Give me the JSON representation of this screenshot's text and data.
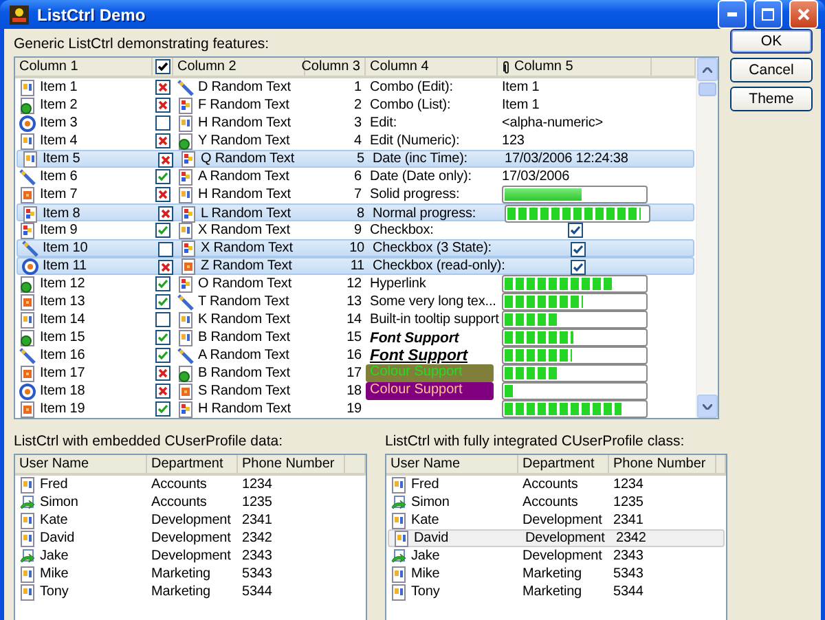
{
  "window": {
    "title": "ListCtrl Demo"
  },
  "main_list": {
    "label": "Generic ListCtrl demonstrating features:",
    "columns": [
      {
        "kind": "text",
        "label": "Column 1"
      },
      {
        "kind": "checkbox",
        "checked": true
      },
      {
        "kind": "text",
        "label": "Column 2"
      },
      {
        "kind": "number",
        "label": "Column 3"
      },
      {
        "kind": "text",
        "label": "Column 4"
      },
      {
        "kind": "attachment",
        "label": "Column 5"
      }
    ],
    "rows": [
      {
        "name": "Item 1",
        "checked": true,
        "crossed": true,
        "text2": "D Random Text",
        "number": "1",
        "label": {
          "kind": "plain",
          "text": "Combo (Edit):"
        },
        "value": {
          "kind": "text",
          "text": "Item 1"
        },
        "selected": false
      },
      {
        "name": "Item 2",
        "checked": true,
        "crossed": true,
        "text2": "F Random Text",
        "number": "2",
        "label": {
          "kind": "plain",
          "text": "Combo (List):"
        },
        "value": {
          "kind": "text",
          "text": "Item 1"
        },
        "selected": false
      },
      {
        "name": "Item 3",
        "checked": false,
        "text2": "H Random Text",
        "number": "3",
        "label": {
          "kind": "plain",
          "text": "Edit:"
        },
        "value": {
          "kind": "text",
          "text": "<alpha-numeric>"
        },
        "selected": false
      },
      {
        "name": "Item 4",
        "checked": true,
        "crossed": true,
        "text2": "Y Random Text",
        "number": "4",
        "label": {
          "kind": "plain",
          "text": "Edit (Numeric):"
        },
        "value": {
          "kind": "text",
          "text": "123"
        },
        "selected": false
      },
      {
        "name": "Item 5",
        "checked": true,
        "crossed": true,
        "text2": "Q Random Text",
        "number": "5",
        "label": {
          "kind": "plain",
          "text": "Date (inc Time):"
        },
        "value": {
          "kind": "text",
          "text": "17/03/2006 12:24:38"
        },
        "selected": true
      },
      {
        "name": "Item 6",
        "checked": true,
        "crossed": false,
        "text2": "A Random Text",
        "number": "6",
        "label": {
          "kind": "plain",
          "text": "Date (Date only):"
        },
        "value": {
          "kind": "text",
          "text": "17/03/2006"
        },
        "selected": false
      },
      {
        "name": "Item 7",
        "checked": true,
        "crossed": true,
        "text2": "H Random Text",
        "number": "7",
        "label": {
          "kind": "plain",
          "text": "Solid progress:"
        },
        "value": {
          "kind": "solid",
          "level": 0.55
        },
        "selected": false
      },
      {
        "name": "Item 8",
        "checked": true,
        "crossed": true,
        "text2": "L Random Text",
        "number": "8",
        "label": {
          "kind": "plain",
          "text": "Normal progress:"
        },
        "value": {
          "kind": "blocks",
          "level": 0.95
        },
        "selected": true
      },
      {
        "name": "Item 9",
        "checked": true,
        "crossed": false,
        "text2": "X Random Text",
        "number": "9",
        "label": {
          "kind": "plain",
          "text": "Checkbox:"
        },
        "value": {
          "kind": "checkbox",
          "checked": true
        },
        "selected": false
      },
      {
        "name": "Item 10",
        "checked": false,
        "text2": "X Random Text",
        "number": "10",
        "label": {
          "kind": "plain",
          "text": "Checkbox (3 State):"
        },
        "value": {
          "kind": "checkbox",
          "checked": true
        },
        "selected": true
      },
      {
        "name": "Item 11",
        "checked": true,
        "crossed": true,
        "text2": "Z Random Text",
        "number": "11",
        "label": {
          "kind": "plain",
          "text": "Checkbox (read-only):"
        },
        "value": {
          "kind": "checkbox",
          "checked": true
        },
        "selected": true
      },
      {
        "name": "Item 12",
        "checked": true,
        "crossed": false,
        "text2": "O Random Text",
        "number": "12",
        "label": {
          "kind": "plain",
          "text": "Hyperlink"
        },
        "value": {
          "kind": "blocks",
          "level": 0.76
        },
        "selected": false
      },
      {
        "name": "Item 13",
        "checked": true,
        "crossed": false,
        "text2": "T Random Text",
        "number": "13",
        "label": {
          "kind": "plain",
          "text": "Some very long tex..."
        },
        "value": {
          "kind": "blocks",
          "level": 0.56
        },
        "selected": false
      },
      {
        "name": "Item 14",
        "checked": false,
        "text2": "K Random Text",
        "number": "14",
        "label": {
          "kind": "plain",
          "text": "Built-in tooltip support"
        },
        "value": {
          "kind": "blocks",
          "level": 0.39
        },
        "selected": false
      },
      {
        "name": "Item 15",
        "checked": true,
        "crossed": false,
        "text2": "B Random Text",
        "number": "15",
        "label": {
          "kind": "bold",
          "text": "Font Support"
        },
        "value": {
          "kind": "blocks",
          "level": 0.49
        },
        "selected": false
      },
      {
        "name": "Item 16",
        "checked": true,
        "crossed": false,
        "text2": "A Random Text",
        "number": "16",
        "label": {
          "kind": "underlined",
          "text": "Font Support"
        },
        "value": {
          "kind": "blocks",
          "level": 0.48
        },
        "selected": false
      },
      {
        "name": "Item 17",
        "checked": true,
        "crossed": true,
        "text2": "B Random Text",
        "number": "17",
        "label": {
          "kind": "colour",
          "text": "Colour Support",
          "color": "#7f7f3a"
        },
        "value": {
          "kind": "blocks",
          "level": 0.39
        },
        "selected": false
      },
      {
        "name": "Item 18",
        "checked": true,
        "crossed": true,
        "text2": "S Random Text",
        "number": "18",
        "label": {
          "kind": "colour",
          "text": "Colour Support",
          "color": "#800080"
        },
        "value": {
          "kind": "blocks",
          "level": 0.08
        },
        "selected": false
      },
      {
        "name": "Item 19",
        "checked": true,
        "crossed": false,
        "text2": "H Random Text",
        "number": "19",
        "value": {
          "kind": "blocks",
          "level": 0.83
        },
        "selected": false
      }
    ]
  },
  "buttons": [
    {
      "label": "OK",
      "default": true
    },
    {
      "label": "Cancel",
      "default": false
    },
    {
      "label": "Theme",
      "default": false
    }
  ],
  "user_lists": [
    {
      "label": "ListCtrl with embedded CUserProfile data:",
      "columns": [
        "User Name",
        "Department",
        "Phone Number"
      ],
      "rows": [
        {
          "name": "Fred",
          "department": "Accounts",
          "phone": "1234",
          "selected": false
        },
        {
          "name": "Simon",
          "department": "Accounts",
          "phone": "1235",
          "selected": false
        },
        {
          "name": "Kate",
          "department": "Development",
          "phone": "2341",
          "selected": false
        },
        {
          "name": "David",
          "department": "Development",
          "phone": "2342",
          "selected": false
        },
        {
          "name": "Jake",
          "department": "Development",
          "phone": "2343",
          "selected": false
        },
        {
          "name": "Mike",
          "department": "Marketing",
          "phone": "5343",
          "selected": false
        },
        {
          "name": "Tony",
          "department": "Marketing",
          "phone": "5344",
          "selected": false
        }
      ]
    },
    {
      "label": "ListCtrl with fully integrated CUserProfile class:",
      "columns": [
        "User Name",
        "Department",
        "Phone Number"
      ],
      "rows": [
        {
          "name": "Fred",
          "department": "Accounts",
          "phone": "1234",
          "selected": false
        },
        {
          "name": "Simon",
          "department": "Accounts",
          "phone": "1235",
          "selected": false
        },
        {
          "name": "Kate",
          "department": "Development",
          "phone": "2341",
          "selected": false
        },
        {
          "name": "David",
          "department": "Development",
          "phone": "2342",
          "selected": true
        },
        {
          "name": "Jake",
          "department": "Development",
          "phone": "2343",
          "selected": false
        },
        {
          "name": "Mike",
          "department": "Marketing",
          "phone": "5343",
          "selected": false
        },
        {
          "name": "Tony",
          "department": "Marketing",
          "phone": "5344",
          "selected": false
        }
      ]
    }
  ]
}
